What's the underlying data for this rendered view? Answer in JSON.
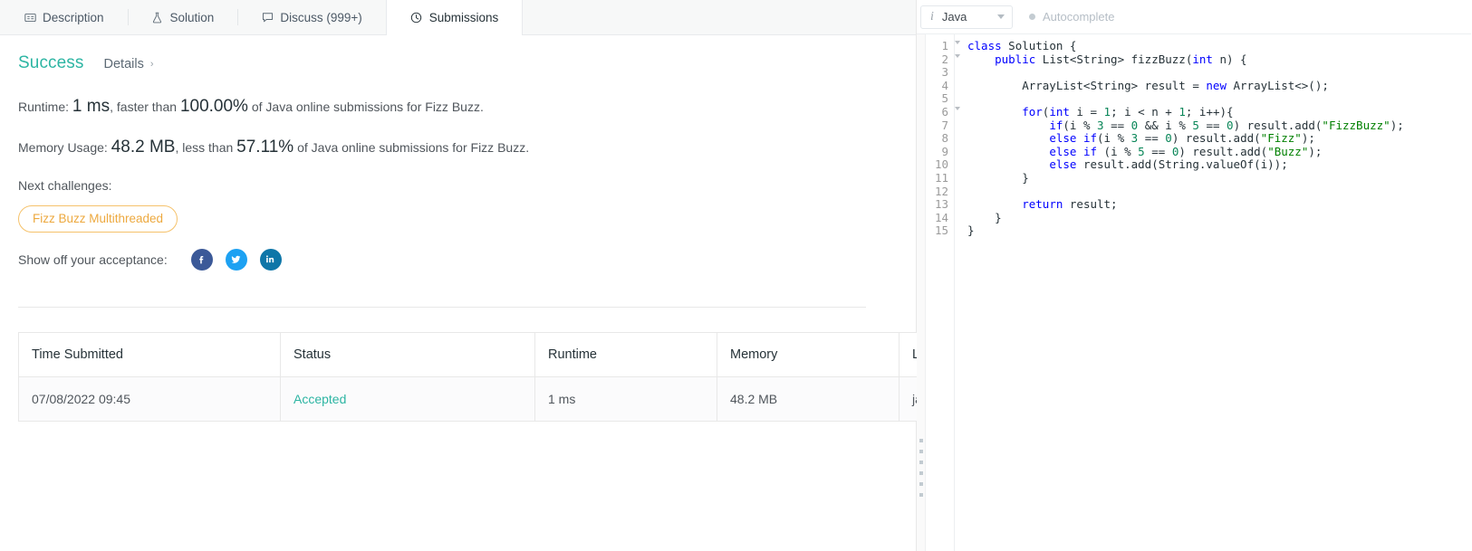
{
  "tabs": [
    {
      "label": "Description",
      "icon": "description-icon",
      "active": false
    },
    {
      "label": "Solution",
      "icon": "flask-icon",
      "active": false
    },
    {
      "label": "Discuss (999+)",
      "icon": "comment-icon",
      "active": false
    },
    {
      "label": "Submissions",
      "icon": "clock-icon",
      "active": true
    }
  ],
  "result": {
    "status": "Success",
    "details_label": "Details",
    "details_chevron": "›",
    "runtime": {
      "prefix": "Runtime:",
      "value": "1 ms",
      "middle": ", faster than ",
      "percent": "100.00%",
      "suffix": " of Java online submissions for Fizz Buzz."
    },
    "memory": {
      "prefix": "Memory Usage:",
      "value": "48.2 MB",
      "middle": ", less than ",
      "percent": "57.11%",
      "suffix": " of Java online submissions for Fizz Buzz."
    },
    "next_challenges_label": "Next challenges:",
    "challenge_chip": "Fizz Buzz Multithreaded",
    "share_label": "Show off your acceptance:",
    "social": [
      {
        "name": "facebook-share-icon",
        "color": "#3b5998"
      },
      {
        "name": "twitter-share-icon",
        "color": "#1da1f2"
      },
      {
        "name": "linkedin-share-icon",
        "color": "#0e76a8"
      }
    ]
  },
  "table": {
    "headers": [
      "Time Submitted",
      "Status",
      "Runtime",
      "Memory",
      "Language"
    ],
    "rows": [
      {
        "time": "07/08/2022 09:45",
        "status": "Accepted",
        "runtime": "1 ms",
        "memory": "48.2 MB",
        "language": "java"
      }
    ]
  },
  "editor": {
    "language": "Java",
    "info_glyph": "i",
    "autocomplete_label": "Autocomplete",
    "line_numbers": [
      "1",
      "2",
      "3",
      "4",
      "5",
      "6",
      "7",
      "8",
      "9",
      "10",
      "11",
      "12",
      "13",
      "14",
      "15"
    ],
    "folds": [
      1,
      2,
      6
    ],
    "code_lines": [
      "class Solution {",
      "    public List<String> fizzBuzz(int n) {",
      "",
      "        ArrayList<String> result = new ArrayList<>();",
      "",
      "        for(int i = 1; i < n + 1; i++){",
      "            if(i % 3 == 0 && i % 5 == 0) result.add(\"FizzBuzz\");",
      "            else if(i % 3 == 0) result.add(\"Fizz\");",
      "            else if (i % 5 == 0) result.add(\"Buzz\");",
      "            else result.add(String.valueOf(i));",
      "        }",
      "",
      "        return result;",
      "    }",
      "}"
    ]
  },
  "colors": {
    "success": "#2db5a3",
    "accepted": "#2db5a3",
    "chip_border": "#f5c26b",
    "chip_text": "#eda93f",
    "keyword": "#0000ff",
    "string": "#008000",
    "number": "#098658"
  }
}
